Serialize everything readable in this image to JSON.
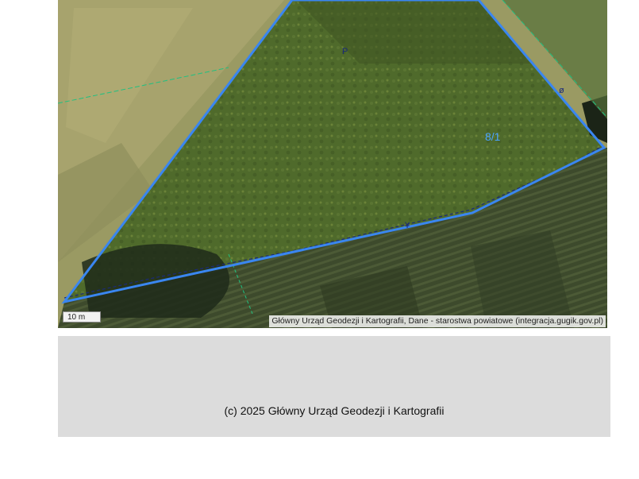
{
  "map": {
    "parcel_number": "8/1",
    "scale_bar_label": "10 m",
    "attribution": "Główny Urząd Geodezji i Kartografii, Dane - starostwa powiatowe (integracja.gugik.gov.pl)",
    "parcel_boundary_color": "#3a86f0",
    "reference_line_color": "#1a2a7a",
    "adjacent_line_color": "#20c080"
  },
  "footer": {
    "copyright": "(c) 2025 Główny Urząd Geodezji i Kartografii"
  }
}
